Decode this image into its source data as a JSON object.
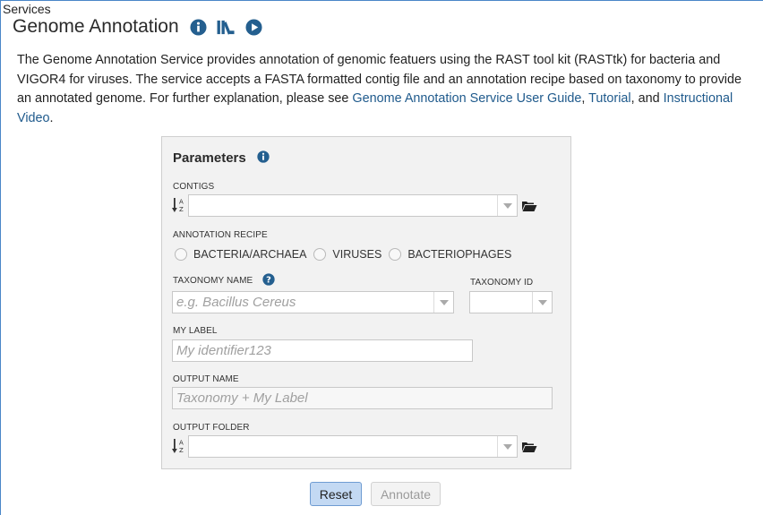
{
  "breadcrumb": "Services",
  "page_title": "Genome Annotation",
  "description": {
    "text": "The Genome Annotation Service provides annotation of genomic featuers using the RAST tool kit (RASTtk) for bacteria and VIGOR4 for viruses. The service accepts a FASTA formatted contig file and an annotation recipe based on taxonomy to provide an annotated genome. For further explanation, please see ",
    "link_user_guide": "Genome Annotation Service User Guide",
    "sep1": ", ",
    "link_tutorial": "Tutorial",
    "sep2": ", and ",
    "link_video": "Instructional Video",
    "end": "."
  },
  "parameters": {
    "title": "Parameters",
    "contigs_label": "CONTIGS",
    "contigs_value": "",
    "recipe_label": "ANNOTATION RECIPE",
    "recipe_options": [
      "BACTERIA/ARCHAEA",
      "VIRUSES",
      "BACTERIOPHAGES"
    ],
    "taxonomy_name_label": "TAXONOMY NAME",
    "taxonomy_name_placeholder": "e.g. Bacillus Cereus",
    "taxonomy_id_label": "TAXONOMY ID",
    "taxonomy_id_value": "",
    "my_label_label": "MY LABEL",
    "my_label_placeholder": "My identifier123",
    "output_name_label": "OUTPUT NAME",
    "output_name_placeholder": "Taxonomy + My Label",
    "output_folder_label": "OUTPUT FOLDER",
    "output_folder_value": ""
  },
  "buttons": {
    "reset": "Reset",
    "annotate": "Annotate"
  },
  "colors": {
    "link": "#1f5a8c",
    "icon": "#245f8f",
    "reset_bg": "#c3d9f3"
  },
  "icons": [
    "info-icon",
    "library-icon",
    "play-icon",
    "sort-alpha-icon",
    "folder-open-icon",
    "question-icon"
  ]
}
